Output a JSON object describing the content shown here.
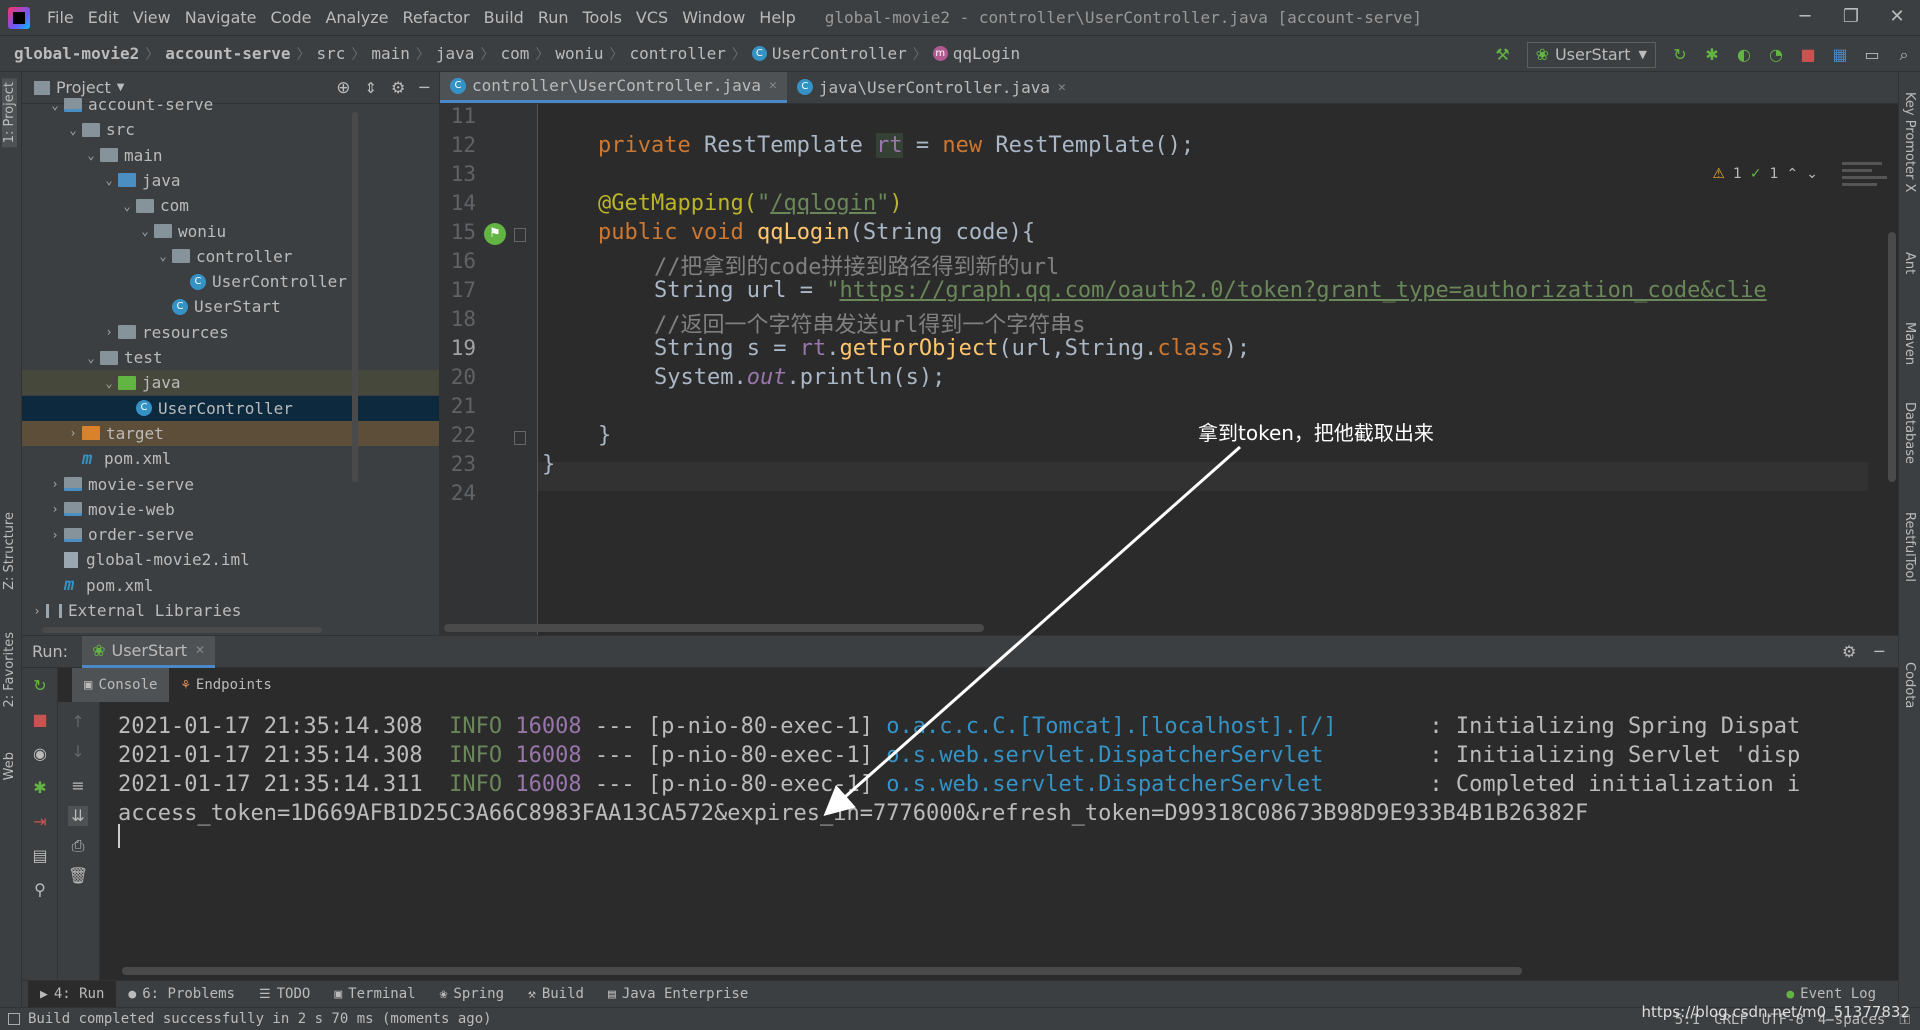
{
  "menu": {
    "items": [
      "File",
      "Edit",
      "View",
      "Navigate",
      "Code",
      "Analyze",
      "Refactor",
      "Build",
      "Run",
      "Tools",
      "VCS",
      "Window",
      "Help"
    ],
    "window_title": "global-movie2 - controller\\UserController.java [account-serve]"
  },
  "breadcrumb": [
    "global-movie2",
    "account-serve",
    "src",
    "main",
    "java",
    "com",
    "woniu",
    "controller",
    "UserController",
    "qqLogin"
  ],
  "run_config": "UserStart",
  "left_stripe": {
    "project": "1: Project",
    "structure": "Z: Structure",
    "favorites": "2: Favorites",
    "web": "Web"
  },
  "right_stripe": [
    "Key Promoter X",
    "Ant",
    "Maven",
    "Database",
    "RestfulTool",
    "Codota"
  ],
  "project": {
    "title": "Project",
    "tree": [
      {
        "label": "account-serve",
        "depth": 1,
        "arrow": "v",
        "icon": "module"
      },
      {
        "label": "src",
        "depth": 2,
        "arrow": "v",
        "icon": "folder"
      },
      {
        "label": "main",
        "depth": 3,
        "arrow": "v",
        "icon": "folder"
      },
      {
        "label": "java",
        "depth": 4,
        "arrow": "v",
        "icon": "folder-blue"
      },
      {
        "label": "com",
        "depth": 5,
        "arrow": "v",
        "icon": "folder"
      },
      {
        "label": "woniu",
        "depth": 6,
        "arrow": "v",
        "icon": "folder"
      },
      {
        "label": "controller",
        "depth": 7,
        "arrow": "v",
        "icon": "folder"
      },
      {
        "label": "UserController",
        "depth": 8,
        "arrow": "",
        "icon": "class"
      },
      {
        "label": "UserStart",
        "depth": 7,
        "arrow": "",
        "icon": "class"
      },
      {
        "label": "resources",
        "depth": 4,
        "arrow": ">",
        "icon": "folder"
      },
      {
        "label": "test",
        "depth": 3,
        "arrow": "v",
        "icon": "folder"
      },
      {
        "label": "java",
        "depth": 4,
        "arrow": "v",
        "icon": "folder-green",
        "state": "green"
      },
      {
        "label": "UserController",
        "depth": 5,
        "arrow": "",
        "icon": "class",
        "state": "active"
      },
      {
        "label": "target",
        "depth": 2,
        "arrow": ">",
        "icon": "folder-orange",
        "state": "orange"
      },
      {
        "label": "pom.xml",
        "depth": 2,
        "arrow": "",
        "icon": "maven"
      },
      {
        "label": "movie-serve",
        "depth": 1,
        "arrow": ">",
        "icon": "module"
      },
      {
        "label": "movie-web",
        "depth": 1,
        "arrow": ">",
        "icon": "module"
      },
      {
        "label": "order-serve",
        "depth": 1,
        "arrow": ">",
        "icon": "module"
      },
      {
        "label": "global-movie2.iml",
        "depth": 1,
        "arrow": "",
        "icon": "file"
      },
      {
        "label": "pom.xml",
        "depth": 1,
        "arrow": "",
        "icon": "maven"
      },
      {
        "label": "External Libraries",
        "depth": 0,
        "arrow": ">",
        "icon": "lib"
      }
    ]
  },
  "editor": {
    "tabs": [
      {
        "label": "controller\\UserController.java",
        "active": true
      },
      {
        "label": "java\\UserController.java",
        "active": false
      }
    ],
    "inspections": {
      "warnings": "1",
      "ok": "1"
    },
    "line_numbers": [
      "11",
      "12",
      "13",
      "14",
      "15",
      "16",
      "17",
      "18",
      "19",
      "20",
      "21",
      "22",
      "23",
      "24"
    ],
    "current_line": "19",
    "code": {
      "l12_kw": "private ",
      "l12_type": "RestTemplate ",
      "l12_var": "rt",
      "l12_eq": " = ",
      "l12_new": "new ",
      "l12_rest": "RestTemplate();",
      "l14_ann": "@GetMapping(",
      "l14_q1": "\"",
      "l14_path": "/qqlogin",
      "l14_q2": "\"",
      "l14_end": ")",
      "l15_kw": "public void ",
      "l15_fn": "qqLogin",
      "l15_rest": "(String code){",
      "l16_cmt": "//把拿到的code拼接到路径得到新的url",
      "l17_decl": "String url = ",
      "l17_q": "\"",
      "l17_url": "https://graph.qq.com/oauth2.0/token?grant_type=authorization_code&clie",
      "l18_cmt": "//返回一个字符串发送url得到一个字符串s",
      "l19_decl": "String s = ",
      "l19_var": "rt",
      "l19_dot": ".",
      "l19_fn": "getForObject",
      "l19_args": "(url,String.",
      "l19_class": "class",
      "l19_end": ");",
      "l20_sys": "System.",
      "l20_out": "out",
      "l20_rest": ".println(s);",
      "l22_brace": "}",
      "l23_brace": "}"
    }
  },
  "run": {
    "label": "Run:",
    "tab": "UserStart",
    "subtabs": [
      "Console",
      "Endpoints"
    ],
    "console": [
      {
        "ts": "2021-01-17 21:35:14.308",
        "level": "INFO",
        "pid": "16008",
        "sep": "---",
        "thread": "[p-nio-80-exec-1]",
        "logger": "o.a.c.c.C.[Tomcat].[localhost].[/]",
        "msg": ": Initializing Spring Dispat"
      },
      {
        "ts": "2021-01-17 21:35:14.308",
        "level": "INFO",
        "pid": "16008",
        "sep": "---",
        "thread": "[p-nio-80-exec-1]",
        "logger": "o.s.web.servlet.DispatcherServlet",
        "msg": ": Initializing Servlet 'disp"
      },
      {
        "ts": "2021-01-17 21:35:14.311",
        "level": "INFO",
        "pid": "16008",
        "sep": "---",
        "thread": "[p-nio-80-exec-1]",
        "logger": "o.s.web.servlet.DispatcherServlet",
        "msg": ": Completed initialization i"
      }
    ],
    "token_line": "access_token=1D669AFB1D25C3A66C8983FAA13CA572&expires_in=7776000&refresh_token=D99318C08673B98D9E933B4B1B26382F"
  },
  "bottom_tabs": [
    {
      "label": "4: Run",
      "icon": "▶",
      "active": true
    },
    {
      "label": "6: Problems",
      "icon": "●",
      "active": false
    },
    {
      "label": "TODO",
      "icon": "☰",
      "active": false
    },
    {
      "label": "Terminal",
      "icon": "▣",
      "active": false
    },
    {
      "label": "Spring",
      "icon": "❀",
      "active": false
    },
    {
      "label": "Build",
      "icon": "⚒",
      "active": false
    },
    {
      "label": "Java Enterprise",
      "icon": "▤",
      "active": false
    }
  ],
  "event_log": "Event Log",
  "status": {
    "message": "Build completed successfully in 2 s 70 ms (moments ago)",
    "position": "5:1",
    "line_sep": "CRLF",
    "encoding": "UTF-8",
    "indent": "4 spaces"
  },
  "annotation": "拿到token，把他截取出来",
  "watermark": "https://blog.csdn.net/m0_51377832",
  "colors": {
    "accent": "#4a88c7",
    "background": "#2b2b2b",
    "panel": "#3c3f41"
  }
}
